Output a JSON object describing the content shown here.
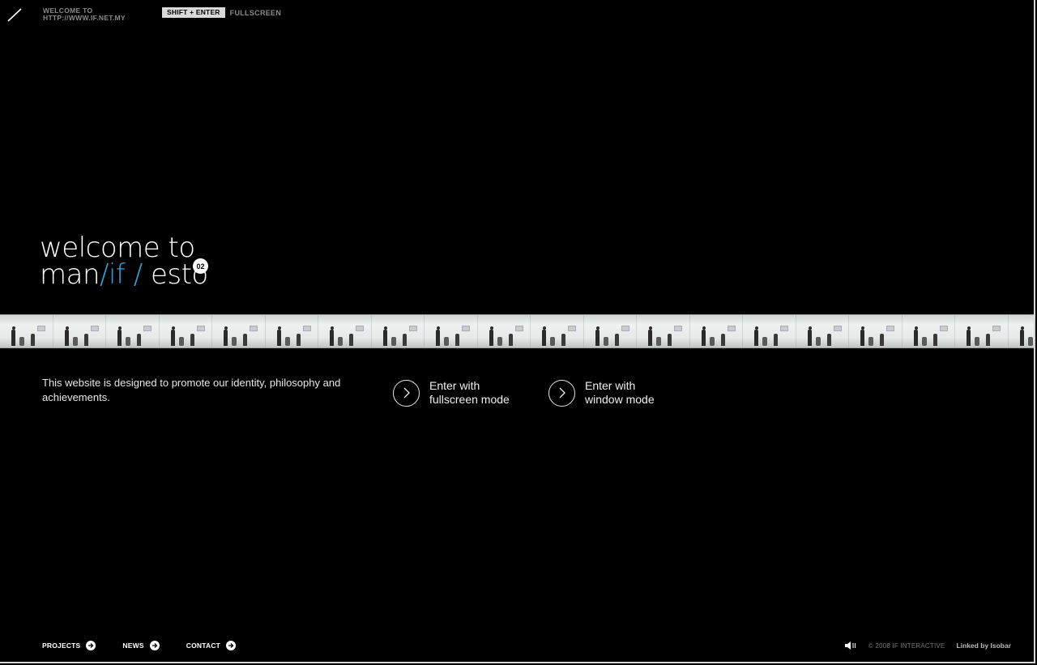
{
  "header": {
    "welcome_line1": "WELCOME TO",
    "welcome_line2": "HTTP://WWW.IF.NET.MY",
    "shortcut_key": "SHIFT + ENTER",
    "shortcut_label": "FULLSCREEN"
  },
  "hero": {
    "line1": "welcome to",
    "line2_part1": "man",
    "line2_accent": "/if /",
    "line2_part2": " esto",
    "badge": "02",
    "accent_color": "#2fa3d6"
  },
  "intro": {
    "description": "This website is designed to promote our identity, philosophy and achievements.",
    "fullscreen_line1": "Enter with",
    "fullscreen_line2": "fullscreen mode",
    "window_line1": "Enter with",
    "window_line2": "window mode"
  },
  "footer": {
    "nav": [
      {
        "label": "PROJECTS"
      },
      {
        "label": "NEWS"
      },
      {
        "label": "CONTACT"
      }
    ],
    "copyright": "© 2008  IF INTERACTIVE",
    "linked": "Linked by Isobar",
    "sound_icon": "speaker-icon"
  }
}
